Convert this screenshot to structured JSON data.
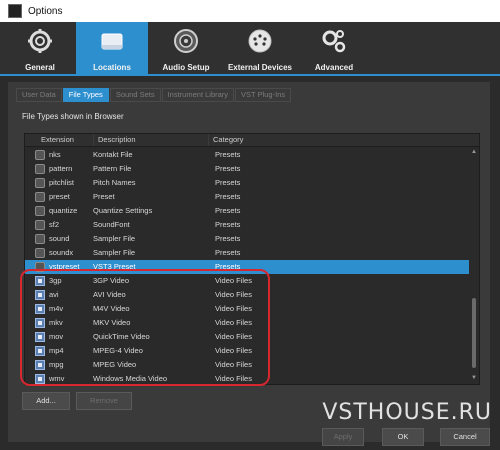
{
  "window": {
    "title": "Options"
  },
  "toolbar": {
    "items": [
      {
        "label": "General",
        "icon": "gear-icon"
      },
      {
        "label": "Locations",
        "icon": "folder-icon"
      },
      {
        "label": "Audio Setup",
        "icon": "speaker-icon"
      },
      {
        "label": "External Devices",
        "icon": "midi-connector-icon"
      },
      {
        "label": "Advanced",
        "icon": "gears-icon"
      }
    ],
    "active": "Locations"
  },
  "tabs": [
    "User Data",
    "File Types",
    "Sound Sets",
    "Instrument Library",
    "VST Plug-Ins"
  ],
  "active_tab": "File Types",
  "section_title": "File Types shown in Browser",
  "table": {
    "columns": [
      "Extension",
      "Description",
      "Category"
    ],
    "rows": [
      {
        "ext": "nks",
        "desc": "Kontakt File",
        "cat": "Presets",
        "icon": "file-icon"
      },
      {
        "ext": "pattern",
        "desc": "Pattern File",
        "cat": "Presets",
        "icon": "grid-icon"
      },
      {
        "ext": "pitchlist",
        "desc": "Pitch Names",
        "cat": "Presets",
        "icon": "list-icon"
      },
      {
        "ext": "preset",
        "desc": "Preset",
        "cat": "Presets",
        "icon": "preset-icon"
      },
      {
        "ext": "quantize",
        "desc": "Quantize Settings",
        "cat": "Presets",
        "icon": "quantize-icon"
      },
      {
        "ext": "sf2",
        "desc": "SoundFont",
        "cat": "Presets",
        "icon": "soundfont-icon"
      },
      {
        "ext": "sound",
        "desc": "Sampler File",
        "cat": "Presets",
        "icon": "waveform-icon"
      },
      {
        "ext": "soundx",
        "desc": "Sampler File",
        "cat": "Presets",
        "icon": "waveform-icon"
      },
      {
        "ext": "vstpreset",
        "desc": "VST3 Preset",
        "cat": "Presets",
        "icon": "vst-icon",
        "selected": true
      },
      {
        "ext": "3gp",
        "desc": "3GP Video",
        "cat": "Video Files",
        "icon": "video-file-icon"
      },
      {
        "ext": "avi",
        "desc": "AVI Video",
        "cat": "Video Files",
        "icon": "video-file-icon"
      },
      {
        "ext": "m4v",
        "desc": "M4V Video",
        "cat": "Video Files",
        "icon": "video-file-icon"
      },
      {
        "ext": "mkv",
        "desc": "MKV Video",
        "cat": "Video Files",
        "icon": "video-file-icon"
      },
      {
        "ext": "mov",
        "desc": "QuickTime Video",
        "cat": "Video Files",
        "icon": "video-file-icon"
      },
      {
        "ext": "mp4",
        "desc": "MPEG-4 Video",
        "cat": "Video Files",
        "icon": "video-file-icon"
      },
      {
        "ext": "mpg",
        "desc": "MPEG Video",
        "cat": "Video Files",
        "icon": "video-file-icon"
      },
      {
        "ext": "wmv",
        "desc": "Windows Media Video",
        "cat": "Video Files",
        "icon": "video-file-icon"
      }
    ]
  },
  "buttons": {
    "add": "Add...",
    "remove": "Remove",
    "apply": "Apply",
    "ok": "OK",
    "cancel": "Cancel"
  },
  "watermark": "VSTHOUSE.RU",
  "colors": {
    "accent": "#2e8fcf",
    "highlight": "#d7262e"
  }
}
